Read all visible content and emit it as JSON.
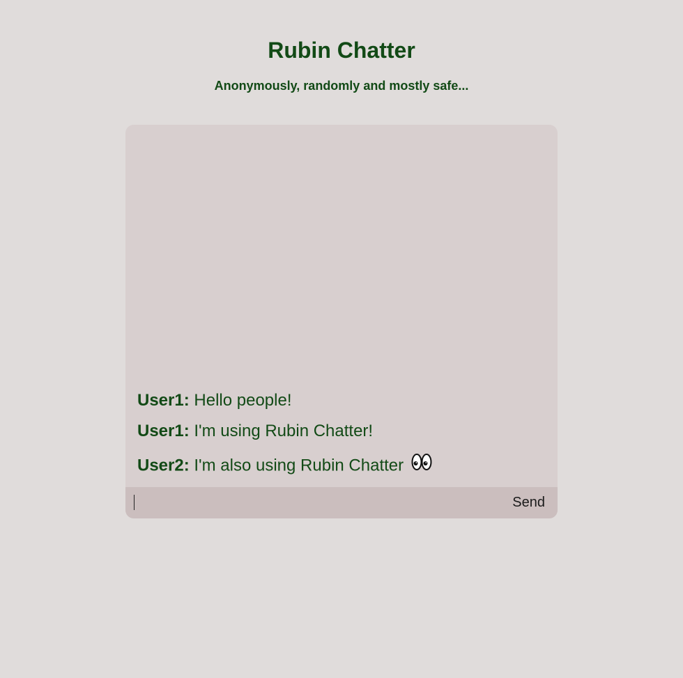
{
  "header": {
    "title": "Rubin Chatter",
    "subtitle": "Anonymously, randomly and mostly safe..."
  },
  "messages": [
    {
      "user": "User1:",
      "text": "Hello people!"
    },
    {
      "user": "User1:",
      "text": "I'm using Rubin Chatter!"
    },
    {
      "user": "User2:",
      "text": "I'm also using Rubin Chatter",
      "emoji": "eyes-icon"
    }
  ],
  "composer": {
    "value": "",
    "placeholder": "",
    "send_label": "Send"
  },
  "colors": {
    "background": "#e0dcdb",
    "chat_background": "#d8cfcf",
    "input_bar": "#cbbebe",
    "accent_text": "#124a16"
  }
}
